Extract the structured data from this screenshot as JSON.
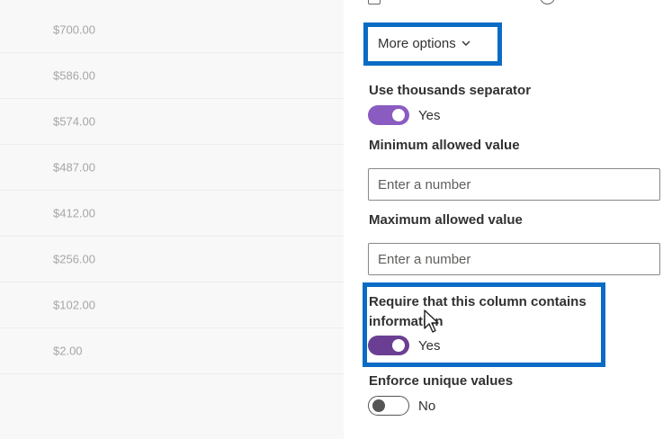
{
  "list": {
    "amounts": [
      "$700.00",
      "$586.00",
      "$574.00",
      "$487.00",
      "$412.00",
      "$256.00",
      "$102.00",
      "$2.00"
    ]
  },
  "panel": {
    "more_options_label": "More options",
    "thousands": {
      "label": "Use thousands separator",
      "state_text": "Yes",
      "on": true
    },
    "min": {
      "label": "Minimum allowed value",
      "placeholder": "Enter a number",
      "value": ""
    },
    "max": {
      "label": "Maximum allowed value",
      "placeholder": "Enter a number",
      "value": ""
    },
    "require": {
      "label": "Require that this column contains information",
      "state_text": "Yes",
      "on": true
    },
    "unique": {
      "label": "Enforce unique values",
      "state_text": "No",
      "on": false
    }
  },
  "colors": {
    "highlight": "#0a6bc5",
    "toggle_on": "#8a5bc0",
    "toggle_on_hover": "#6a3f93"
  },
  "icons": {
    "more_options": "chevron-down-icon",
    "pointer": "mouse-cursor-icon"
  }
}
